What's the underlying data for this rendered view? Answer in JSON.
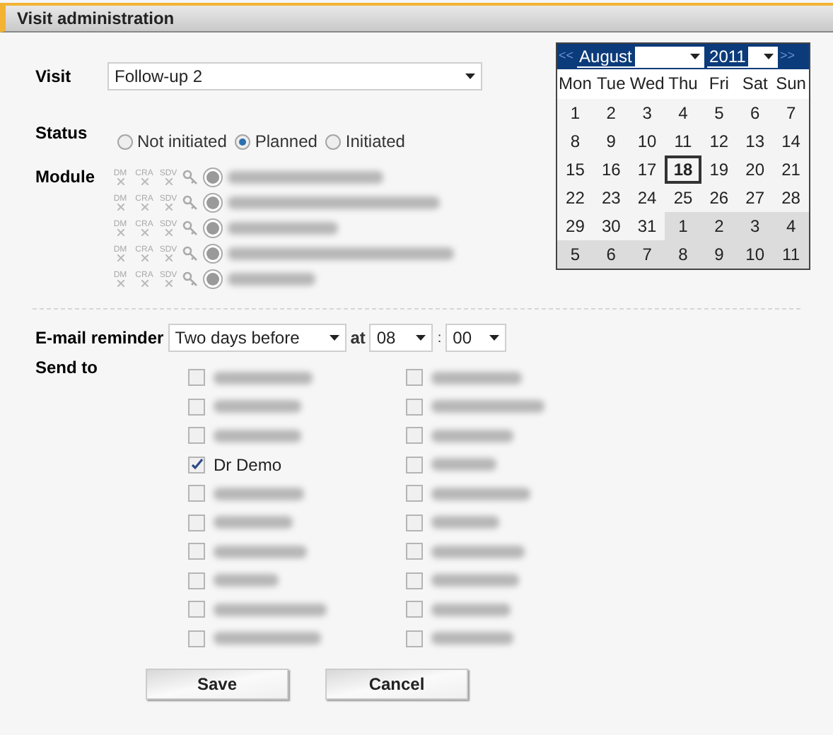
{
  "panel": {
    "title": "Visit administration"
  },
  "visit": {
    "label": "Visit",
    "value": "Follow-up 2"
  },
  "status": {
    "label": "Status",
    "options": [
      {
        "label": "Not initiated",
        "selected": false
      },
      {
        "label": "Planned",
        "selected": true
      },
      {
        "label": "Initiated",
        "selected": false
      }
    ]
  },
  "module": {
    "label": "Module",
    "rows": [
      {
        "roles": [
          "DM",
          "CRA",
          "SDV"
        ]
      },
      {
        "roles": [
          "DM",
          "CRA",
          "SDV"
        ]
      },
      {
        "roles": [
          "DM",
          "CRA",
          "SDV"
        ]
      },
      {
        "roles": [
          "DM",
          "CRA",
          "SDV"
        ]
      },
      {
        "roles": [
          "DM",
          "CRA",
          "SDV"
        ]
      }
    ]
  },
  "calendar": {
    "prev": "<<",
    "next": ">>",
    "month": "August",
    "year": "2011",
    "weekdays": [
      "Mon",
      "Tue",
      "Wed",
      "Thu",
      "Fri",
      "Sat",
      "Sun"
    ],
    "weeks": [
      [
        {
          "day": "1",
          "outside": false,
          "selected": false
        },
        {
          "day": "2",
          "outside": false,
          "selected": false
        },
        {
          "day": "3",
          "outside": false,
          "selected": false
        },
        {
          "day": "4",
          "outside": false,
          "selected": false
        },
        {
          "day": "5",
          "outside": false,
          "selected": false
        },
        {
          "day": "6",
          "outside": false,
          "selected": false
        },
        {
          "day": "7",
          "outside": false,
          "selected": false
        }
      ],
      [
        {
          "day": "8",
          "outside": false,
          "selected": false
        },
        {
          "day": "9",
          "outside": false,
          "selected": false
        },
        {
          "day": "10",
          "outside": false,
          "selected": false
        },
        {
          "day": "11",
          "outside": false,
          "selected": false
        },
        {
          "day": "12",
          "outside": false,
          "selected": false
        },
        {
          "day": "13",
          "outside": false,
          "selected": false
        },
        {
          "day": "14",
          "outside": false,
          "selected": false
        }
      ],
      [
        {
          "day": "15",
          "outside": false,
          "selected": false
        },
        {
          "day": "16",
          "outside": false,
          "selected": false
        },
        {
          "day": "17",
          "outside": false,
          "selected": false
        },
        {
          "day": "18",
          "outside": false,
          "selected": true
        },
        {
          "day": "19",
          "outside": false,
          "selected": false
        },
        {
          "day": "20",
          "outside": false,
          "selected": false
        },
        {
          "day": "21",
          "outside": false,
          "selected": false
        }
      ],
      [
        {
          "day": "22",
          "outside": false,
          "selected": false
        },
        {
          "day": "23",
          "outside": false,
          "selected": false
        },
        {
          "day": "24",
          "outside": false,
          "selected": false
        },
        {
          "day": "25",
          "outside": false,
          "selected": false
        },
        {
          "day": "26",
          "outside": false,
          "selected": false
        },
        {
          "day": "27",
          "outside": false,
          "selected": false
        },
        {
          "day": "28",
          "outside": false,
          "selected": false
        }
      ],
      [
        {
          "day": "29",
          "outside": false,
          "selected": false
        },
        {
          "day": "30",
          "outside": false,
          "selected": false
        },
        {
          "day": "31",
          "outside": false,
          "selected": false
        },
        {
          "day": "1",
          "outside": true,
          "selected": false
        },
        {
          "day": "2",
          "outside": true,
          "selected": false
        },
        {
          "day": "3",
          "outside": true,
          "selected": false
        },
        {
          "day": "4",
          "outside": true,
          "selected": false
        }
      ],
      [
        {
          "day": "5",
          "outside": true,
          "selected": false
        },
        {
          "day": "6",
          "outside": true,
          "selected": false
        },
        {
          "day": "7",
          "outside": true,
          "selected": false
        },
        {
          "day": "8",
          "outside": true,
          "selected": false
        },
        {
          "day": "9",
          "outside": true,
          "selected": false
        },
        {
          "day": "10",
          "outside": true,
          "selected": false
        },
        {
          "day": "11",
          "outside": true,
          "selected": false
        }
      ]
    ]
  },
  "reminder": {
    "label": "E-mail reminder",
    "when": "Two days before",
    "at": "at",
    "hour": "08",
    "separator": ":",
    "minute": "00"
  },
  "send_to": {
    "label": "Send to",
    "columns": [
      [
        {
          "checked": false
        },
        {
          "checked": false
        },
        {
          "checked": false
        },
        {
          "name": "Dr Demo",
          "checked": true
        },
        {
          "checked": false
        },
        {
          "checked": false
        },
        {
          "checked": false
        },
        {
          "checked": false
        },
        {
          "checked": false
        },
        {
          "checked": false
        }
      ],
      [
        {
          "checked": false
        },
        {
          "checked": false
        },
        {
          "checked": false
        },
        {
          "checked": false
        },
        {
          "checked": false
        },
        {
          "checked": false
        },
        {
          "checked": false
        },
        {
          "checked": false
        },
        {
          "checked": false
        },
        {
          "checked": false
        }
      ]
    ]
  },
  "buttons": [
    "Save",
    "Cancel"
  ]
}
